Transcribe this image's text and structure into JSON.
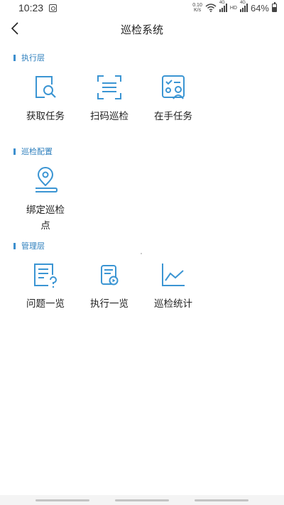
{
  "status_bar": {
    "time": "10:23",
    "net_speed_value": "0.10",
    "net_speed_unit": "K/s",
    "sim1_tag": "4G",
    "hd_tag": "HD",
    "sim2_tag": "4G",
    "battery_percent": "64%",
    "battery_level": 0.64
  },
  "nav": {
    "title": "巡检系统",
    "back_icon": "chevron-left-icon"
  },
  "sections": [
    {
      "title": "执行层",
      "items": [
        {
          "label": "获取任务",
          "icon": "document-search-icon"
        },
        {
          "label": "扫码巡检",
          "icon": "scan-icon"
        },
        {
          "label": "在手任务",
          "icon": "task-checklist-icon"
        }
      ]
    },
    {
      "title": "巡检配置",
      "items": [
        {
          "label": "绑定巡检点",
          "icon": "location-pin-icon"
        }
      ]
    },
    {
      "title": "管理层",
      "items": [
        {
          "label": "问题一览",
          "icon": "question-document-icon"
        },
        {
          "label": "执行一览",
          "icon": "play-document-icon"
        },
        {
          "label": "巡检统计",
          "icon": "line-chart-icon"
        }
      ]
    }
  ],
  "colors": {
    "accent": "#3d8fce",
    "section_title": "#2e7fbd",
    "icon_stroke": "#3b95d3"
  }
}
